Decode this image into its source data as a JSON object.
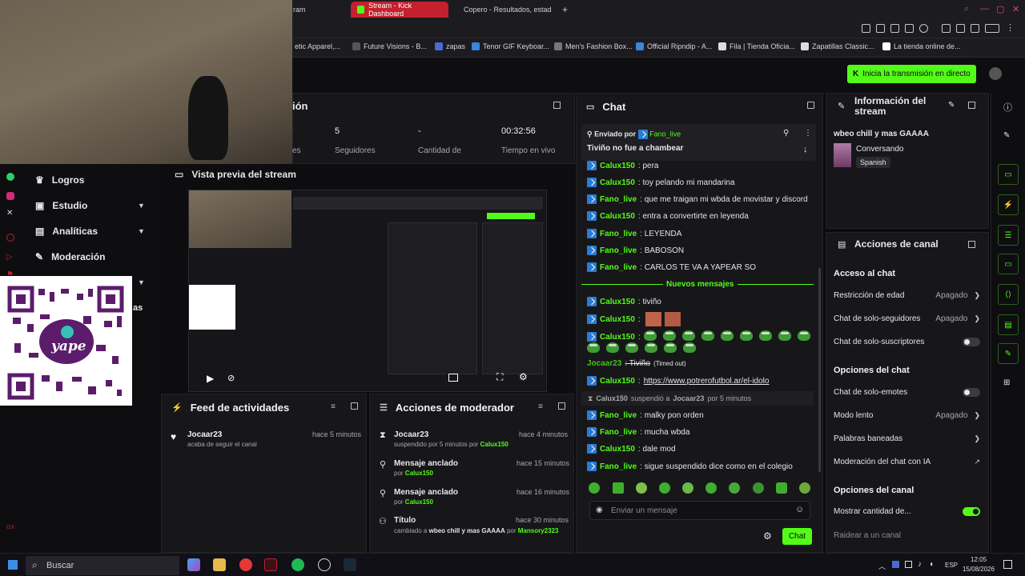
{
  "browser": {
    "tabs": [
      {
        "label": "ram"
      },
      {
        "label": "Stream - Kick Dashboard"
      },
      {
        "label": "Copero - Resultados, estad"
      }
    ],
    "new_tab": "+",
    "bookmarks": [
      {
        "label": "etic Apparel,..."
      },
      {
        "label": "Future Visions - B..."
      },
      {
        "label": "zapas"
      },
      {
        "label": "Tenor GIF Keyboar..."
      },
      {
        "label": "Men's Fashion Box..."
      },
      {
        "label": "Official Ripndip - A..."
      },
      {
        "label": "Fila | Tienda Oficia..."
      },
      {
        "label": "Zapatillas Classic..."
      },
      {
        "label": "La tienda online de..."
      }
    ]
  },
  "header": {
    "go_live": "Inicia la transmisión en directo"
  },
  "sidebar": {
    "items": [
      {
        "label": "Logros"
      },
      {
        "label": "Estudio"
      },
      {
        "label": "Analíticas"
      },
      {
        "label": "Moderación"
      }
    ],
    "partial": "as"
  },
  "session": {
    "title": "ión",
    "stats": [
      {
        "value": "",
        "label": "es"
      },
      {
        "value": "5",
        "label": "Seguidores"
      },
      {
        "value": "-",
        "label": "Cantidad de"
      },
      {
        "value": "00:32:56",
        "label": "Tiempo en vivo"
      }
    ]
  },
  "preview": {
    "title": "Vista previa del stream"
  },
  "feed": {
    "title": "Feed de actividades",
    "items": [
      {
        "user": "Jocaar23",
        "time": "hace 5 minutos",
        "desc": "acaba de seguir el canal"
      }
    ]
  },
  "modactions": {
    "title": "Acciones de moderador",
    "items": [
      {
        "title": "Jocaar23",
        "time": "hace 4 minutos",
        "desc": "suspendido por 5 minutos por",
        "by": "Calux150"
      },
      {
        "title": "Mensaje anclado",
        "time": "hace 15 minutos",
        "desc": "por",
        "by": "Calux150"
      },
      {
        "title": "Mensaje anclado",
        "time": "hace 16 minutos",
        "desc": "por",
        "by": "Calux150"
      },
      {
        "title": "Título",
        "time": "hace 30 minutos",
        "desc": "cambiado a",
        "bold": "wbeo chill y mas GAAAA",
        "desc2": "por",
        "by": "Mansory2323"
      }
    ]
  },
  "chat": {
    "title": "Chat",
    "pinned": {
      "prefix": "Enviado por",
      "user": "Fano_live",
      "text": "Tiviño no fue a chambear"
    },
    "lines": [
      {
        "user": "Calux150",
        "text": ": pera"
      },
      {
        "user": "Calux150",
        "text": ": toy pelando mi mandarina"
      },
      {
        "user": "Fano_live",
        "text": ": que me traigan mi wbda de movistar y discord"
      },
      {
        "user": "Calux150",
        "text": ": entra a convertirte en leyenda"
      },
      {
        "user": "Fano_live",
        "text": ": LEYENDA"
      },
      {
        "user": "Fano_live",
        "text": ": BABOSON"
      },
      {
        "user": "Fano_live",
        "text": ": CARLOS TE VA A YAPEAR SO"
      }
    ],
    "new_messages": "Nuevos mensajes",
    "lines2": [
      {
        "user": "Calux150",
        "text": ": tiviño"
      },
      {
        "user": "Calux150",
        "text": ":"
      },
      {
        "user": "Calux150",
        "text": ":"
      }
    ],
    "timeout_line": {
      "user": "Jocaar23",
      "text": ": Tiviño",
      "tag": "(Timed out)"
    },
    "link_line": {
      "user": "Calux150",
      "text": ": ",
      "link": "https://www.potrerofutbol.ar/el-idolo"
    },
    "suspend_line": {
      "user": "Calux150",
      "text": "suspendió a",
      "target": "Jocaar23",
      "suffix": "por 5 minutos"
    },
    "lines3": [
      {
        "user": "Fano_live",
        "text": ": malky pon orden"
      },
      {
        "user": "Fano_live",
        "text": ": mucha wbda"
      },
      {
        "user": "Calux150",
        "text": ": dale mod"
      },
      {
        "user": "Fano_live",
        "text": ": sigue suspendido dice como en el colegio"
      }
    ],
    "input_placeholder": "Enviar un mensaje",
    "send": "Chat"
  },
  "info": {
    "title": "Información del stream",
    "stream_title": "wbeo chill y mas GAAAA",
    "category": "Conversando",
    "language": "Spanish"
  },
  "channel": {
    "title": "Acciones de canal",
    "chat_access": "Acceso al chat",
    "age": {
      "label": "Restricción de edad",
      "value": "Apagado"
    },
    "followers": {
      "label": "Chat de solo-seguidores",
      "value": "Apagado"
    },
    "subs": {
      "label": "Chat de solo-suscriptores"
    },
    "chat_options": "Opciones del chat",
    "emotes": {
      "label": "Chat de solo-emotes"
    },
    "slow": {
      "label": "Modo lento",
      "value": "Apagado"
    },
    "banned": {
      "label": "Palabras baneadas"
    },
    "ai": {
      "label": "Moderación del chat con IA"
    },
    "channel_options": "Opciones del canal",
    "show_count": {
      "label": "Mostrar cantidad de..."
    },
    "raid": {
      "label": "Raidear a un canal"
    }
  },
  "taskbar": {
    "search": "Buscar",
    "lang": "ESP",
    "time": "12:05",
    "date": "15/08/2026"
  },
  "colors": {
    "accent": "#53fc18",
    "tab_active": "#c4202d",
    "link_blue": "#2b7bd3"
  }
}
